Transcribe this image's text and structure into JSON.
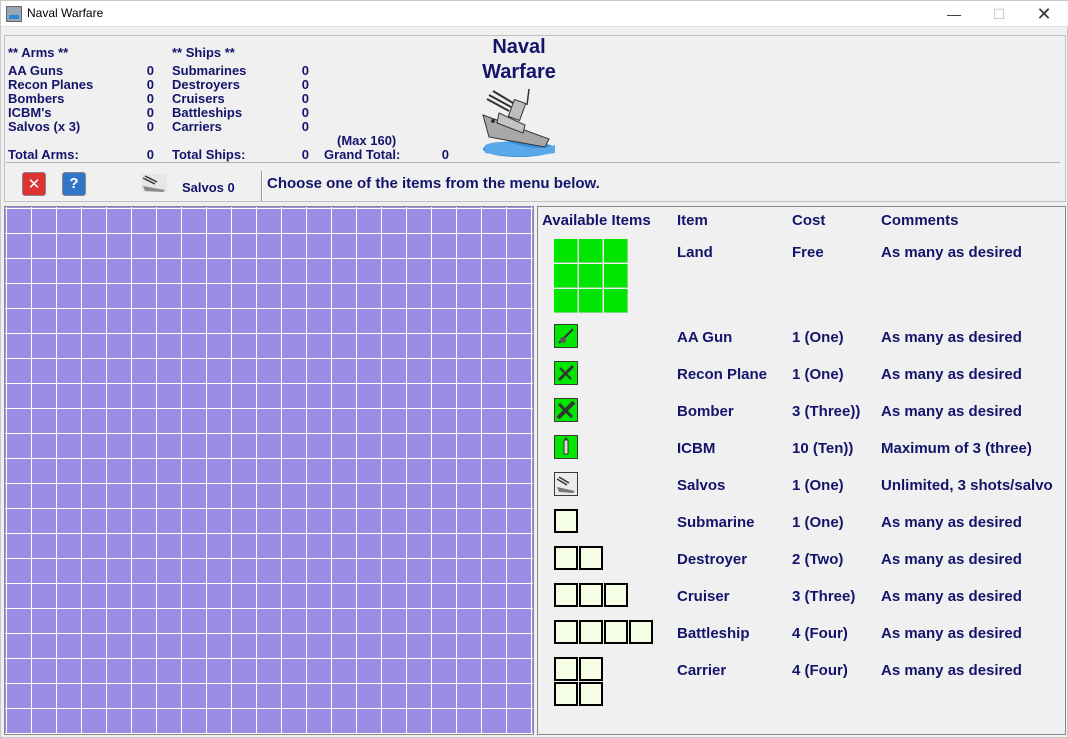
{
  "window": {
    "title": "Naval Warfare",
    "min_glyph": "—",
    "max_glyph": "☐",
    "close_glyph": "✕"
  },
  "stats": {
    "arms_header": "** Arms **",
    "ships_header": "** Ships **",
    "arms": [
      {
        "label": "AA Guns",
        "value": "0"
      },
      {
        "label": "Recon Planes",
        "value": "0"
      },
      {
        "label": "Bombers",
        "value": "0"
      },
      {
        "label": "ICBM's",
        "value": "0"
      },
      {
        "label": "Salvos (x 3)",
        "value": "0"
      }
    ],
    "ships": [
      {
        "label": "Submarines",
        "value": "0"
      },
      {
        "label": "Destroyers",
        "value": "0"
      },
      {
        "label": "Cruisers",
        "value": "0"
      },
      {
        "label": "Battleships",
        "value": "0"
      },
      {
        "label": "Carriers",
        "value": "0"
      }
    ],
    "total_arms_label": "Total Arms:",
    "total_arms_value": "0",
    "total_ships_label": "Total Ships:",
    "total_ships_value": "0",
    "max_note": "(Max 160)",
    "grand_total_label": "Grand Total:",
    "grand_total_value": "0"
  },
  "logo": {
    "line1": "Naval",
    "line2": "Warfare"
  },
  "toolbar": {
    "salvos_label": "Salvos 0",
    "message": "Choose one of the items from the menu below."
  },
  "menu": {
    "headers": {
      "available": "Available Items",
      "item": "Item",
      "cost": "Cost",
      "comments": "Comments"
    },
    "rows": [
      {
        "item": "Land",
        "cost": "Free",
        "comment": "As many as desired"
      },
      {
        "item": "AA Gun",
        "cost": "1 (One)",
        "comment": "As many as desired"
      },
      {
        "item": "Recon Plane",
        "cost": "1 (One)",
        "comment": "As many as desired"
      },
      {
        "item": "Bomber",
        "cost": "3 (Three))",
        "comment": "As many as desired"
      },
      {
        "item": "ICBM",
        "cost": "10 (Ten))",
        "comment": "Maximum of 3 (three)"
      },
      {
        "item": "Salvos",
        "cost": "1 (One)",
        "comment": "Unlimited, 3 shots/salvo"
      },
      {
        "item": "Submarine",
        "cost": "1 (One)",
        "comment": "As many as desired"
      },
      {
        "item": "Destroyer",
        "cost": "2 (Two)",
        "comment": "As many as desired"
      },
      {
        "item": "Cruiser",
        "cost": "3 (Three)",
        "comment": "As many as desired"
      },
      {
        "item": "Battleship",
        "cost": "4 (Four)",
        "comment": "As many as desired"
      },
      {
        "item": "Carrier",
        "cost": "4 (Four)",
        "comment": "As many as desired"
      }
    ]
  },
  "colors": {
    "grid": "#9b8ce6",
    "land": "#00e600",
    "text": "#14146b"
  }
}
